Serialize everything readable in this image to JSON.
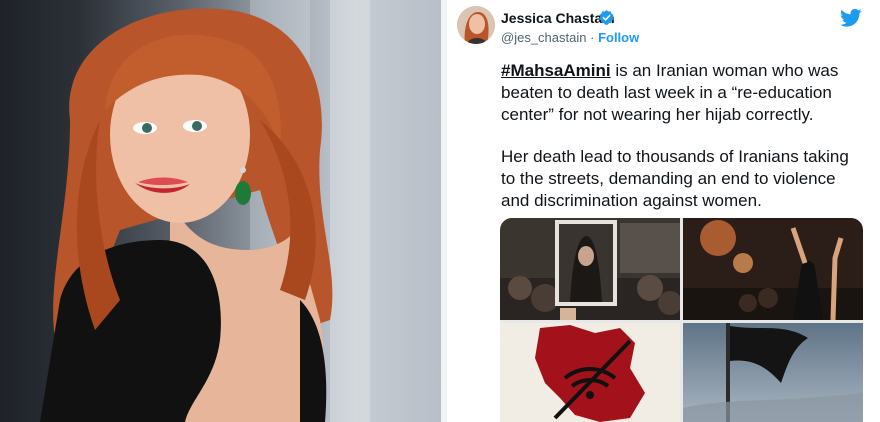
{
  "tweet": {
    "display_name": "Jessica Chastain",
    "handle": "@jes_chastain",
    "separator": "·",
    "follow_label": "Follow",
    "hashtag": "#MahsaAmini",
    "paragraph1_rest": " is an Iranian woman who was beaten to death last week in a “re-education center” for not wearing her hijab correctly.",
    "paragraph2": "Her death lead to thousands of Iranians taking to the streets, demanding an end to violence and discrimination against women.",
    "verified_icon": "verified-badge-icon",
    "brand_icon": "twitter-bird-icon",
    "colors": {
      "link_blue": "#1d9bf0",
      "text": "#0f1419",
      "secondary": "#536471"
    }
  }
}
